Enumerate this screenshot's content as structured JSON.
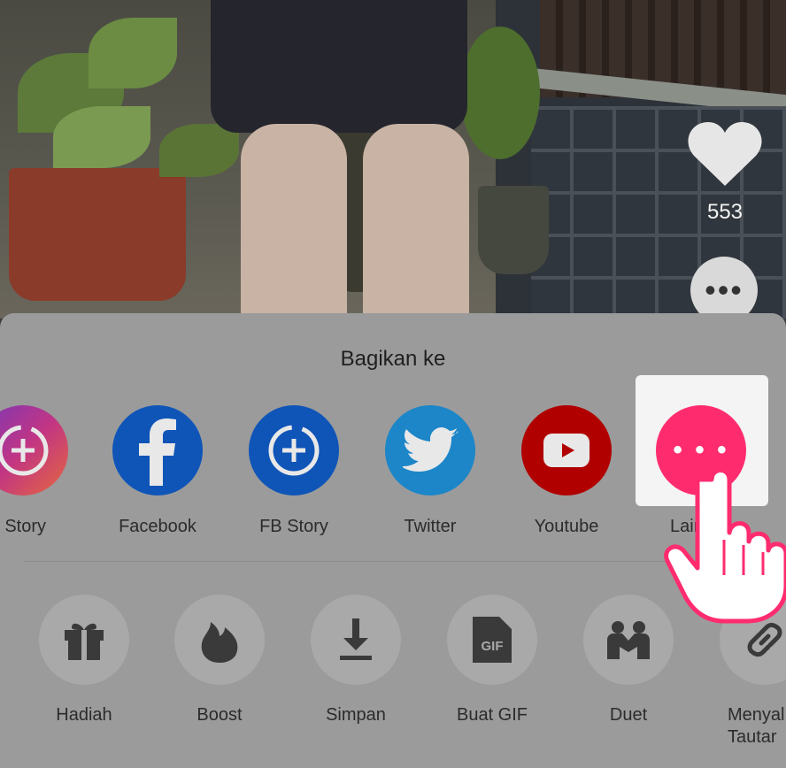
{
  "video": {
    "like_count": "553",
    "icons": [
      "heart-icon",
      "more-icon"
    ]
  },
  "share_sheet": {
    "title": "Bagikan ke",
    "share_targets": [
      {
        "label": "IG Story",
        "visible_label": "S Story",
        "icon": "instagram-story-icon",
        "color": "#c13584"
      },
      {
        "label": "Facebook",
        "icon": "facebook-icon",
        "color": "#0f55b8"
      },
      {
        "label": "FB Story",
        "icon": "facebook-story-icon",
        "color": "#0f55b8"
      },
      {
        "label": "Twitter",
        "icon": "twitter-icon",
        "color": "#1c86c8"
      },
      {
        "label": "Youtube",
        "icon": "youtube-icon",
        "color": "#b00000"
      },
      {
        "label": "Lainnya",
        "visible_label": "Lainnya",
        "icon": "more-icon",
        "color": "#fe2c6f"
      }
    ],
    "actions": [
      {
        "label": "Hadiah",
        "icon": "gift-icon"
      },
      {
        "label": "Boost",
        "icon": "flame-icon"
      },
      {
        "label": "Simpan",
        "icon": "download-icon"
      },
      {
        "label": "Buat GIF",
        "icon": "gif-icon"
      },
      {
        "label": "Duet",
        "icon": "duet-icon"
      },
      {
        "label": "Menyalin Tautan",
        "visible_label": "Menyal\nTautar",
        "icon": "link-icon"
      }
    ]
  },
  "colors": {
    "accent": "#fe2c6f",
    "sheet_bg": "#9b9b9b",
    "highlight": "#f4f4f4"
  }
}
